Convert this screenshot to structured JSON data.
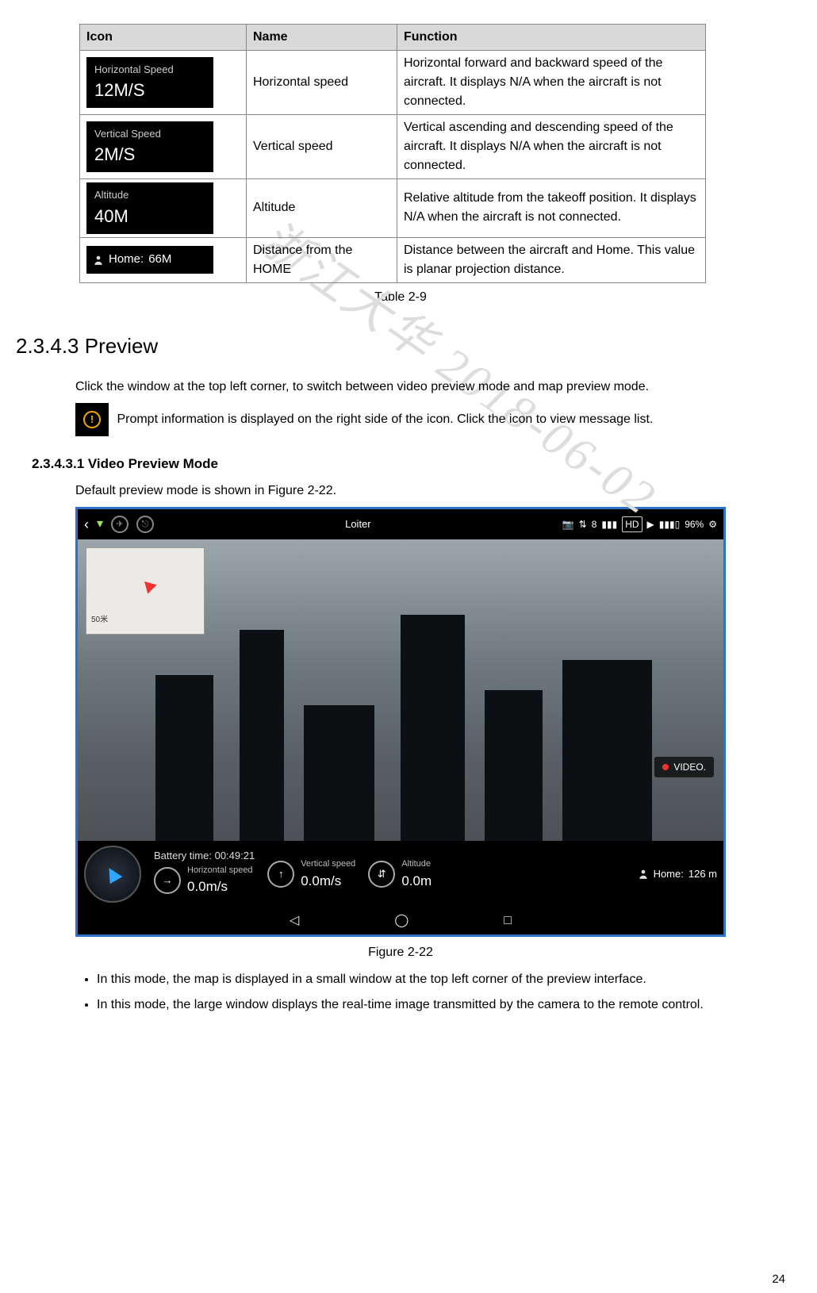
{
  "table": {
    "headers": {
      "icon": "Icon",
      "name": "Name",
      "function": "Function"
    },
    "rows": [
      {
        "icon_label": "Horizontal Speed",
        "icon_value": "12M/S",
        "name": "Horizontal speed",
        "function": "Horizontal forward and backward speed of the aircraft. It displays N/A when the aircraft is not connected."
      },
      {
        "icon_label": "Vertical Speed",
        "icon_value": "2M/S",
        "name": "Vertical speed",
        "function": "Vertical ascending and descending speed of the aircraft. It displays N/A when the aircraft is not connected."
      },
      {
        "icon_label": "Altitude",
        "icon_value": "40M",
        "name": "Altitude",
        "function": "Relative altitude from the takeoff position. It displays N/A when the aircraft is not connected."
      },
      {
        "icon_label": "Home:",
        "icon_value": "66M",
        "name": "Distance from the HOME",
        "function": "Distance between the aircraft and Home. This value is planar projection distance."
      }
    ],
    "caption": "Table 2-9"
  },
  "section": {
    "heading": "2.3.4.3 Preview",
    "para1": "Click the window at the top left corner, to switch between video preview mode and map preview mode.",
    "para2": " Prompt information is displayed on the right side of the icon. Click the icon to view message list."
  },
  "subsection": {
    "heading": "2.3.4.3.1 Video Preview Mode",
    "para": "Default preview mode is shown in Figure 2-22."
  },
  "figure": {
    "topbar": {
      "mode": "Loiter",
      "hd": "HD",
      "battery_pct": "96%",
      "satellites": "8"
    },
    "minimap": {
      "scale": "50米"
    },
    "video_badge": "VIDEO.",
    "hud": {
      "battery_time_label": "Battery time:",
      "battery_time_value": "00:49:21",
      "hs_label": "Horizontal speed",
      "hs_value": "0.0m/s",
      "vs_label": "Vertical speed",
      "vs_value": "0.0m/s",
      "alt_label": "Altitude",
      "alt_value": "0.0m",
      "home_label": "Home:",
      "home_value": "126 m"
    },
    "caption": "Figure 2-22"
  },
  "bullets": [
    "In this mode, the map is displayed in a small window at the top left corner of the preview interface.",
    "In this mode, the large window displays the real-time image transmitted by the camera to the remote control."
  ],
  "watermark": "浙江大华 2018-06-02",
  "page": "24"
}
